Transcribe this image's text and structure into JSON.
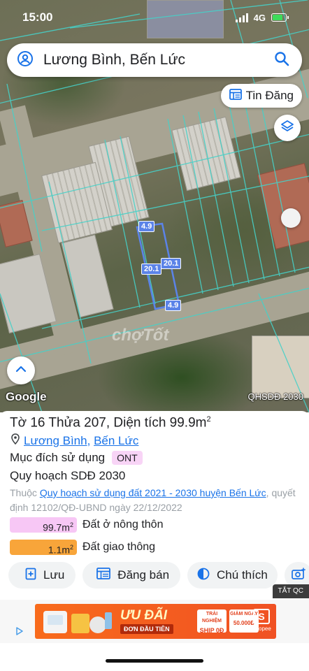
{
  "status_bar": {
    "time": "15:00",
    "network": "4G"
  },
  "search": {
    "query": "Lương Bình, Bến Lức"
  },
  "map": {
    "tin_dang_label": "Tin Đăng",
    "dimension_labels": [
      "4.9",
      "20.1",
      "20.1",
      "4.9"
    ],
    "provider": "Google",
    "layer_label": "QHSDĐ 2030",
    "watermark": "chợTốt"
  },
  "parcel": {
    "title_prefix": "Tờ 16 Thửa 207, Diện tích 99.9m",
    "title_sup": "2",
    "location_ward": "Lương Bình",
    "location_sep": ",",
    "location_district": "Bến Lức",
    "purpose_label": "Mục đích sử dụng",
    "purpose_code": "ONT",
    "plan_label": "Quy hoạch SDĐ 2030",
    "belongs_prefix": "Thuộc",
    "belongs_link": "Quy hoạch sử dụng đất 2021 - 2030 huyện Bến Lức",
    "belongs_suffix": ", quyết định 12102/QĐ-UBND ngày 22/12/2022",
    "land_use": [
      {
        "area": "99.7m",
        "sup": "2",
        "name": "Đất ở nông thôn",
        "color": "#f7c7f5",
        "share": 0.998
      },
      {
        "area": "1.1m",
        "sup": "2",
        "name": "Đất giao thông",
        "color": "#f8a53a",
        "share": 0.011
      }
    ]
  },
  "actions": {
    "save": "Lưu",
    "sell": "Đăng bán",
    "legend": "Chú thích"
  },
  "ad": {
    "close_label": "TẮT QC",
    "headline": "ƯU ĐÃI",
    "subline": "ĐƠN ĐẦU TIÊN",
    "coupon_1_top": "TRẢI NGHIỆM",
    "coupon_1_main": "SHIP 0Đ",
    "coupon_2_top": "GIẢM NGAY",
    "coupon_2_main": "50.000Đ",
    "brand": "Shopee"
  },
  "colors": {
    "accent_link": "#1a73e8",
    "parcel_outline": "#5b83e8",
    "cadastral_lines": "#46d1c8",
    "chip_bg": "#f1f3f4"
  }
}
